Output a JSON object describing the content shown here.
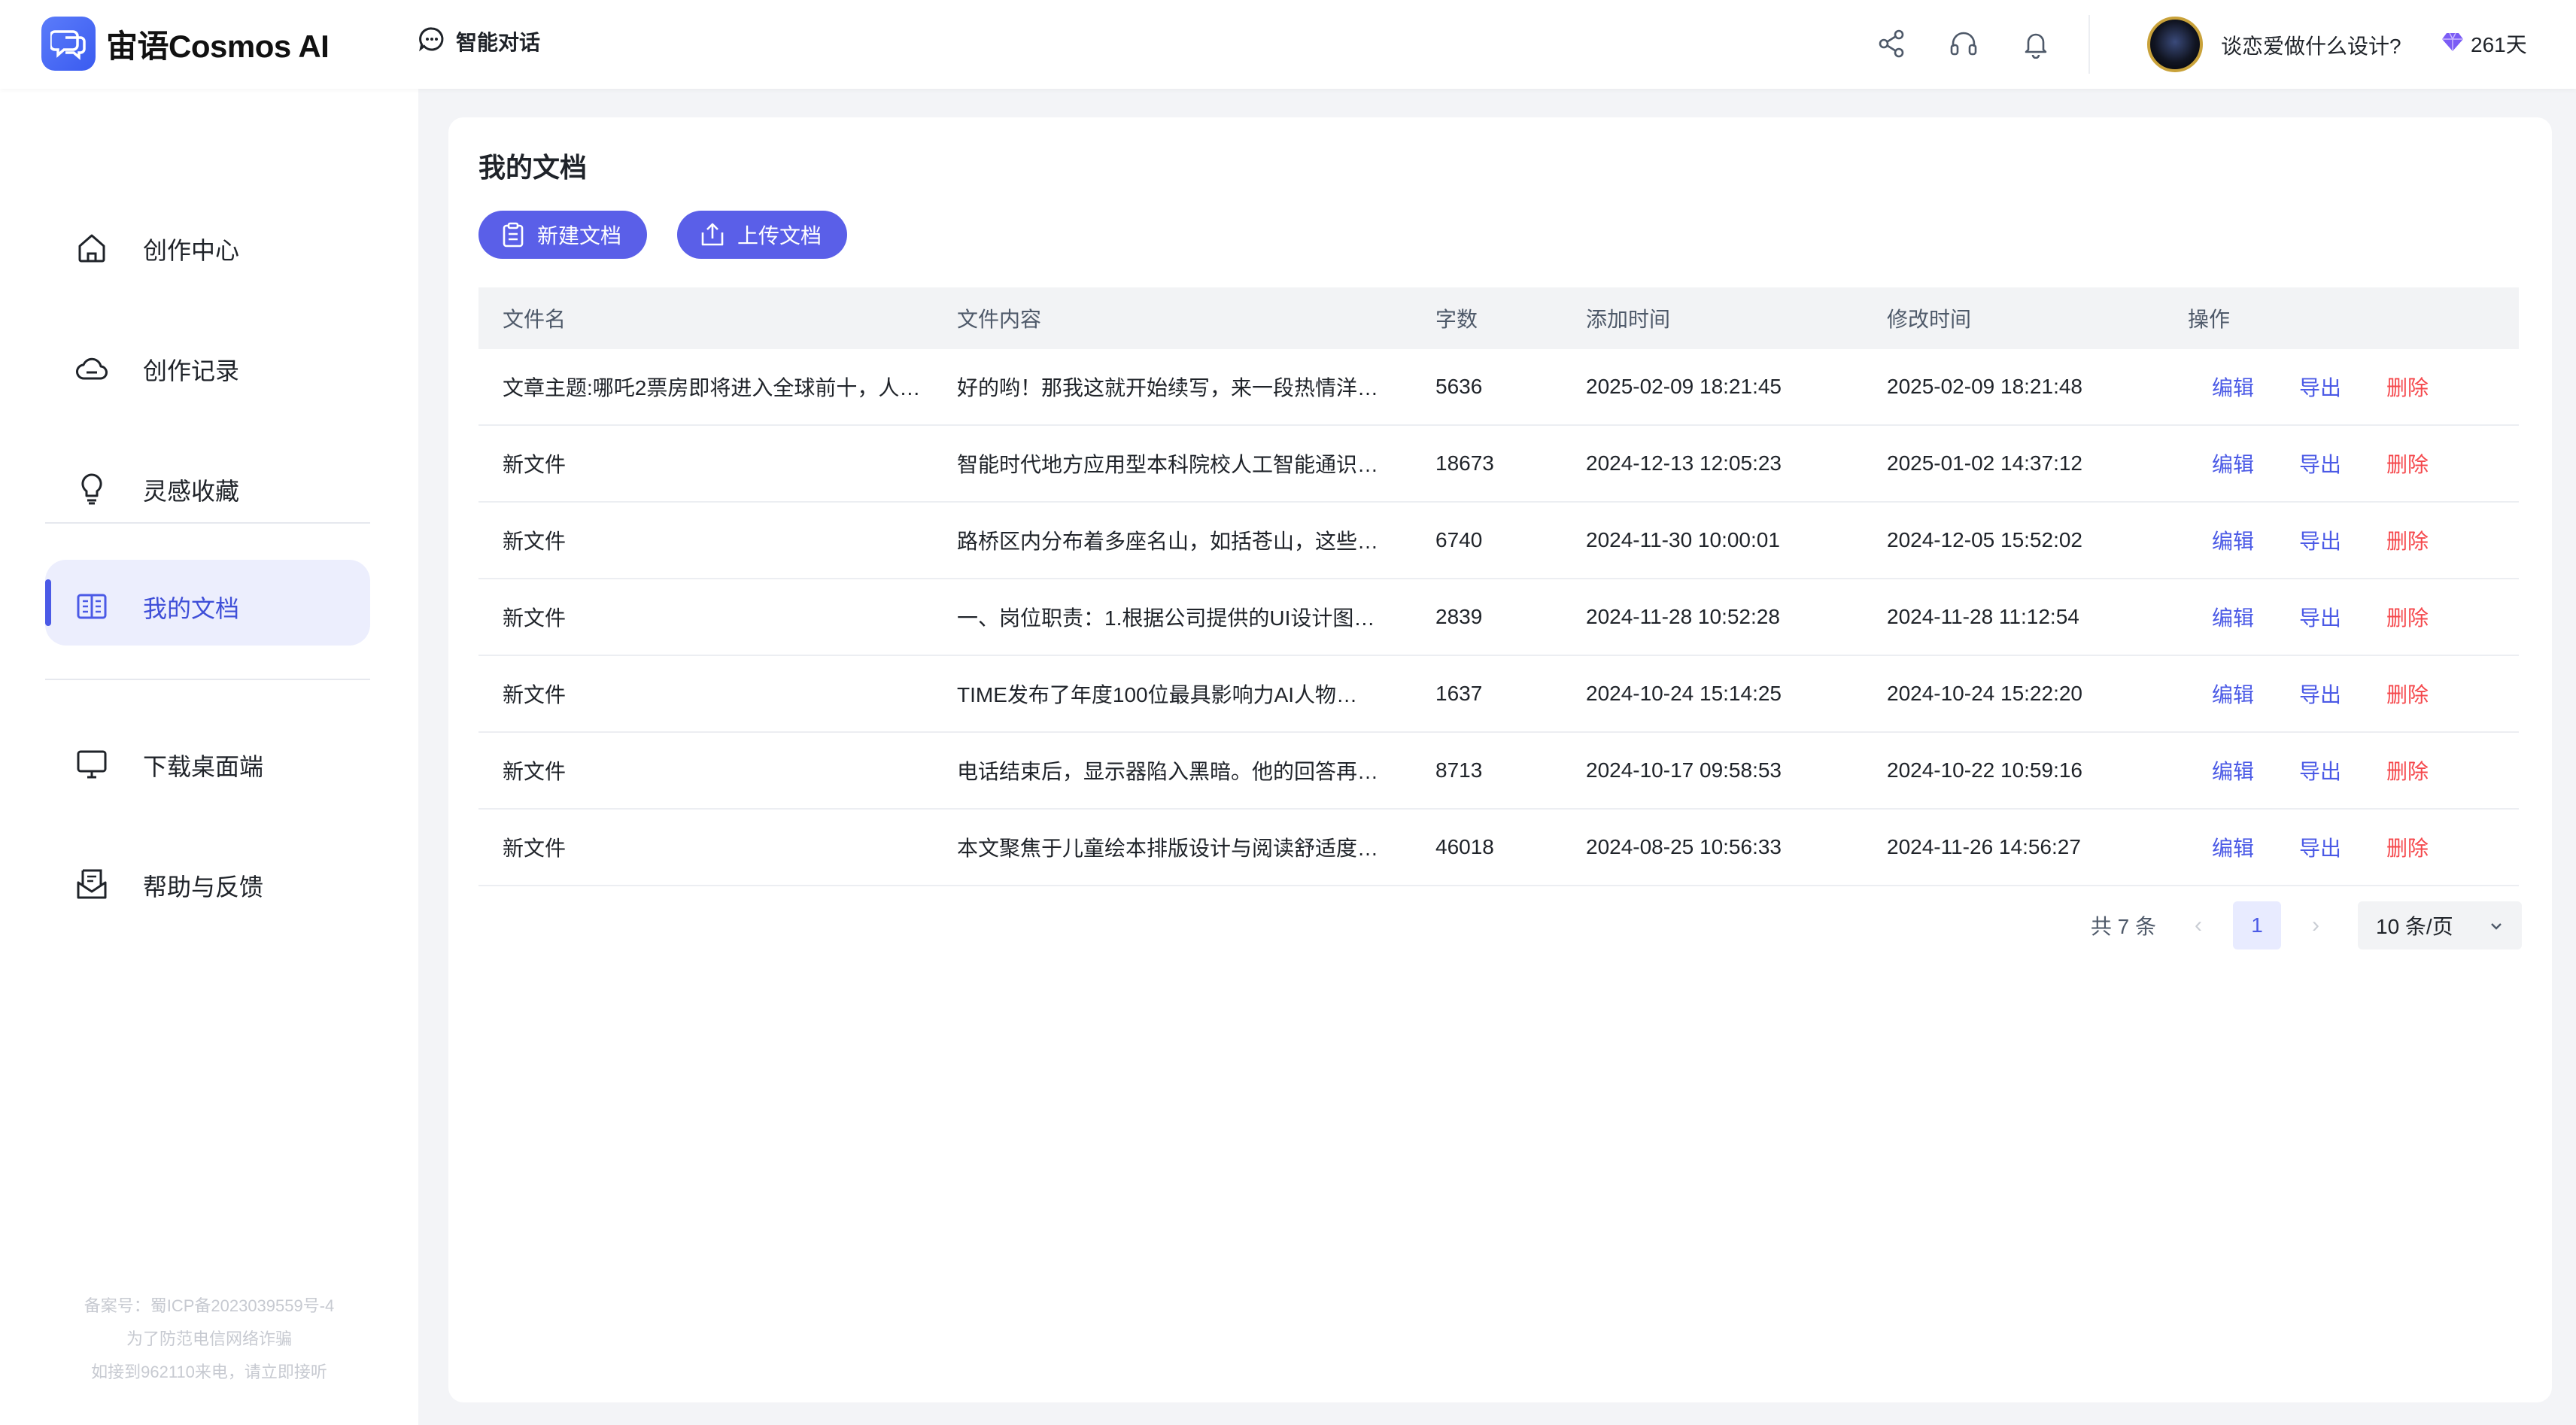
{
  "header": {
    "app_name": "宙语Cosmos AI",
    "chat_tab_label": "智能对话",
    "user_name": "谈恋爱做什么设计?",
    "vip_days": "261天"
  },
  "sidebar": {
    "items": [
      {
        "label": "创作中心",
        "icon": "home-icon"
      },
      {
        "label": "创作记录",
        "icon": "cloud-icon"
      },
      {
        "label": "灵感收藏",
        "icon": "lightbulb-icon"
      },
      {
        "label": "我的文档",
        "icon": "document-icon",
        "active": true
      },
      {
        "label": "下载桌面端",
        "icon": "monitor-icon"
      },
      {
        "label": "帮助与反馈",
        "icon": "feedback-icon"
      }
    ],
    "footer": {
      "line1": "备案号：蜀ICP备2023039559号-4",
      "line2": "为了防范电信网络诈骗",
      "line3": "如接到962110来电，请立即接听"
    }
  },
  "main": {
    "title": "我的文档",
    "new_doc_label": "新建文档",
    "upload_doc_label": "上传文档",
    "columns": [
      "文件名",
      "文件内容",
      "字数",
      "添加时间",
      "修改时间",
      "操作"
    ],
    "rows": [
      {
        "name": "文章主题:哪吒2票房即将进入全球前十，人…",
        "content": "好的哟！那我这就开始续写，来一段热情洋…",
        "words": "5636",
        "added": "2025-02-09 18:21:45",
        "modified": "2025-02-09 18:21:48"
      },
      {
        "name": "新文件",
        "content": "智能时代地方应用型本科院校人工智能通识…",
        "words": "18673",
        "added": "2024-12-13 12:05:23",
        "modified": "2025-01-02 14:37:12"
      },
      {
        "name": "新文件",
        "content": "路桥区内分布着多座名山，如括苍山，这些…",
        "words": "6740",
        "added": "2024-11-30 10:00:01",
        "modified": "2024-12-05 15:52:02"
      },
      {
        "name": "新文件",
        "content": "一、岗位职责：1.根据公司提供的UI设计图…",
        "words": "2839",
        "added": "2024-11-28 10:52:28",
        "modified": "2024-11-28 11:12:54"
      },
      {
        "name": "新文件",
        "content": "TIME发布了年度100位最具影响力AI人物名…",
        "words": "1637",
        "added": "2024-10-24 15:14:25",
        "modified": "2024-10-24 15:22:20"
      },
      {
        "name": "新文件",
        "content": "电话结束后，显示器陷入黑暗。他的回答再…",
        "words": "8713",
        "added": "2024-10-17 09:58:53",
        "modified": "2024-10-22 10:59:16"
      },
      {
        "name": "新文件",
        "content": "本文聚焦于儿童绘本排版设计与阅读舒适度…",
        "words": "46018",
        "added": "2024-08-25 10:56:33",
        "modified": "2024-11-26 14:56:27"
      }
    ],
    "actions": {
      "edit": "编辑",
      "export": "导出",
      "delete": "删除"
    },
    "pagination": {
      "total": "共 7 条",
      "prev": "‹",
      "current": "1",
      "next": "›",
      "page_size": "10 条/页"
    }
  },
  "colors": {
    "accent": "#5a5fe8",
    "link": "#4b5ae6",
    "danger": "#f5484c",
    "active_bg": "#eceefd"
  }
}
